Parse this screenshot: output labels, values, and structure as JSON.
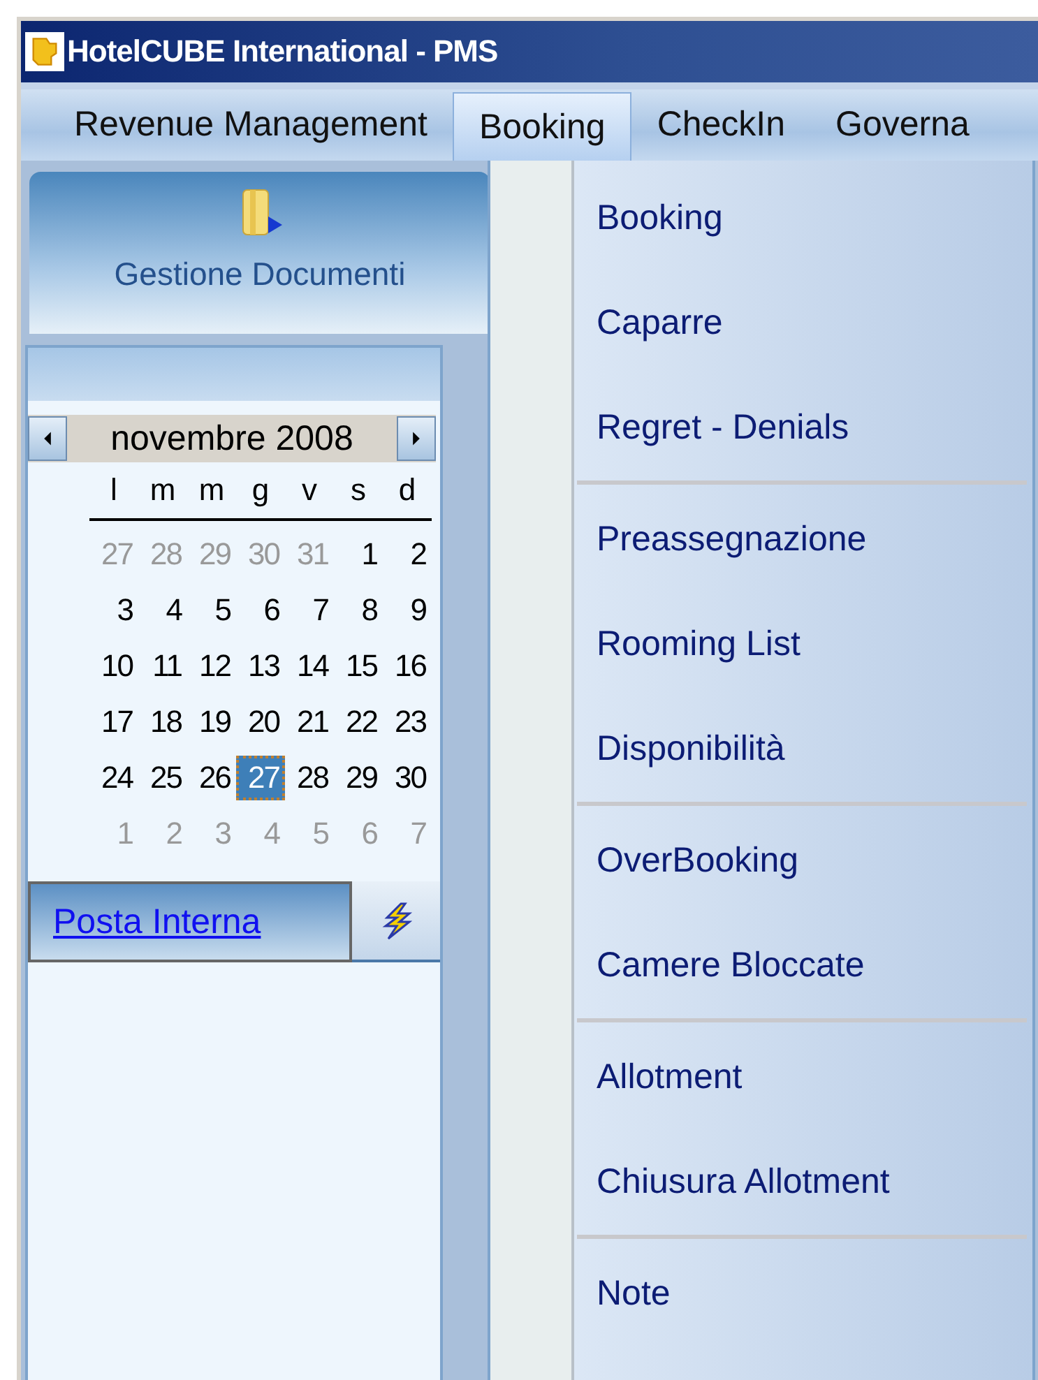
{
  "window": {
    "title": "HotelCUBE International -  PMS"
  },
  "menubar": [
    {
      "label": "Revenue Management",
      "selected": false
    },
    {
      "label": "Booking",
      "selected": true
    },
    {
      "label": "CheckIn",
      "selected": false
    },
    {
      "label": "Governa",
      "selected": false
    }
  ],
  "shortcut": {
    "label": "Gestione Documenti"
  },
  "calendar": {
    "month": "novembre 2008",
    "weekdays": [
      "l",
      "m",
      "m",
      "g",
      "v",
      "s",
      "d"
    ],
    "weeks": [
      [
        {
          "label": "27",
          "muted": true,
          "selected": false
        },
        {
          "label": "28",
          "muted": true,
          "selected": false
        },
        {
          "label": "29",
          "muted": true,
          "selected": false
        },
        {
          "label": "30",
          "muted": true,
          "selected": false
        },
        {
          "label": "31",
          "muted": true,
          "selected": false
        },
        {
          "label": "1",
          "muted": false,
          "selected": false
        },
        {
          "label": "2",
          "muted": false,
          "selected": false
        }
      ],
      [
        {
          "label": "3",
          "muted": false,
          "selected": false
        },
        {
          "label": "4",
          "muted": false,
          "selected": false
        },
        {
          "label": "5",
          "muted": false,
          "selected": false
        },
        {
          "label": "6",
          "muted": false,
          "selected": false
        },
        {
          "label": "7",
          "muted": false,
          "selected": false
        },
        {
          "label": "8",
          "muted": false,
          "selected": false
        },
        {
          "label": "9",
          "muted": false,
          "selected": false
        }
      ],
      [
        {
          "label": "10",
          "muted": false,
          "selected": false
        },
        {
          "label": "11",
          "muted": false,
          "selected": false
        },
        {
          "label": "12",
          "muted": false,
          "selected": false
        },
        {
          "label": "13",
          "muted": false,
          "selected": false
        },
        {
          "label": "14",
          "muted": false,
          "selected": false
        },
        {
          "label": "15",
          "muted": false,
          "selected": false
        },
        {
          "label": "16",
          "muted": false,
          "selected": false
        }
      ],
      [
        {
          "label": "17",
          "muted": false,
          "selected": false
        },
        {
          "label": "18",
          "muted": false,
          "selected": false
        },
        {
          "label": "19",
          "muted": false,
          "selected": false
        },
        {
          "label": "20",
          "muted": false,
          "selected": false
        },
        {
          "label": "21",
          "muted": false,
          "selected": false
        },
        {
          "label": "22",
          "muted": false,
          "selected": false
        },
        {
          "label": "23",
          "muted": false,
          "selected": false
        }
      ],
      [
        {
          "label": "24",
          "muted": false,
          "selected": false
        },
        {
          "label": "25",
          "muted": false,
          "selected": false
        },
        {
          "label": "26",
          "muted": false,
          "selected": false
        },
        {
          "label": "27",
          "muted": false,
          "selected": true
        },
        {
          "label": "28",
          "muted": false,
          "selected": false
        },
        {
          "label": "29",
          "muted": false,
          "selected": false
        },
        {
          "label": "30",
          "muted": false,
          "selected": false
        }
      ],
      [
        {
          "label": "1",
          "muted": true,
          "selected": false
        },
        {
          "label": "2",
          "muted": true,
          "selected": false
        },
        {
          "label": "3",
          "muted": true,
          "selected": false
        },
        {
          "label": "4",
          "muted": true,
          "selected": false
        },
        {
          "label": "5",
          "muted": true,
          "selected": false
        },
        {
          "label": "6",
          "muted": true,
          "selected": false
        },
        {
          "label": "7",
          "muted": true,
          "selected": false
        }
      ]
    ]
  },
  "mail": {
    "label": "Posta Interna"
  },
  "dropdown": {
    "groups": [
      {
        "items": [
          "Booking",
          "Caparre",
          "Regret - Denials"
        ]
      },
      {
        "items": [
          "Preassegnazione",
          "Rooming List",
          "Disponibilità"
        ]
      },
      {
        "items": [
          "OverBooking",
          "Camere Bloccate"
        ]
      },
      {
        "items": [
          "Allotment",
          "Chiusura Allotment"
        ]
      },
      {
        "items": [
          "Note"
        ]
      }
    ]
  }
}
